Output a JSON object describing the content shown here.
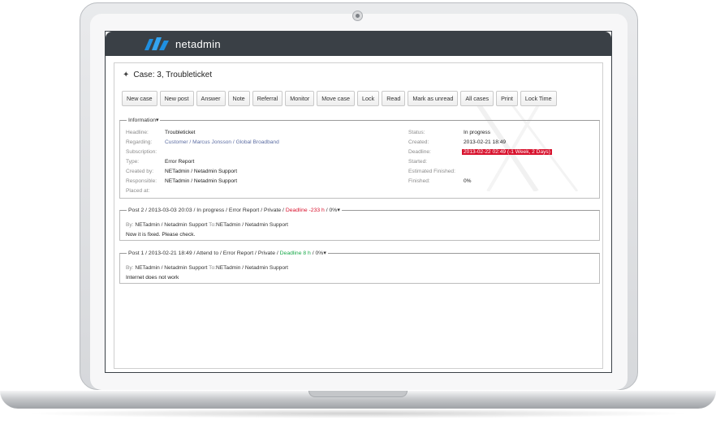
{
  "app": {
    "brand": "netadmin"
  },
  "case": {
    "title": "Case: 3, Troubleticket"
  },
  "toolbar": [
    "New case",
    "New post",
    "Answer",
    "Note",
    "Referral",
    "Monitor",
    "Move case",
    "Lock",
    "Read",
    "Mark as unread",
    "All cases",
    "Print",
    "Lock Time"
  ],
  "info": {
    "legend": "Information",
    "left": [
      {
        "label": "Headline:",
        "value": "Troubleticket"
      },
      {
        "label": "Regarding:",
        "value": "Customer / Marcus Jonsson / Global Broadband"
      },
      {
        "label": "Subscription:",
        "value": ""
      },
      {
        "label": "Type:",
        "value": "Error Report"
      },
      {
        "label": "Created by:",
        "value": "NETadmin / Netadmin Support"
      },
      {
        "label": "Responsible:",
        "value": "NETadmin / Netadmin Support"
      },
      {
        "label": "Placed at:",
        "value": ""
      }
    ],
    "right": [
      {
        "label": "Status:",
        "value": "In progress"
      },
      {
        "label": "Created:",
        "value": "2013-02-21 18:49"
      },
      {
        "label": "Deadline:",
        "value": "2013-02-22 02:49 (-1 Week, 2 Days)"
      },
      {
        "label": "Started:",
        "value": ""
      },
      {
        "label": "Estimated Finished:",
        "value": ""
      },
      {
        "label": "Finished:",
        "value": "0%"
      }
    ]
  },
  "posts": [
    {
      "legend_prefix": "Post 2 / 2013-03-03 20:03 / In progress / Error Report / Private / ",
      "deadline": "Deadline -233 h",
      "legend_suffix": " / 0%",
      "by_label": "By:",
      "by": "NETadmin / Netadmin Support",
      "to_label": "To:",
      "to": "NETadmin / Netadmin Support",
      "body": "Now it is fixed. Please check."
    },
    {
      "legend_prefix": "Post 1 / 2013-02-21 18:49 / Attend to / Error Report / Private / ",
      "deadline": "Deadline 8 h",
      "legend_suffix": " / 0%",
      "by_label": "By:",
      "by": "NETadmin / Netadmin Support",
      "to_label": "To:",
      "to": "NETadmin / Netadmin Support",
      "body": "Internet does not work"
    }
  ],
  "colors": {
    "topbar": "#3a4046",
    "deadline_red": "#d8132e",
    "deadline_green": "#1aa84a",
    "link": "#5d6ea3",
    "logo_blue": "#1f8fe0"
  }
}
